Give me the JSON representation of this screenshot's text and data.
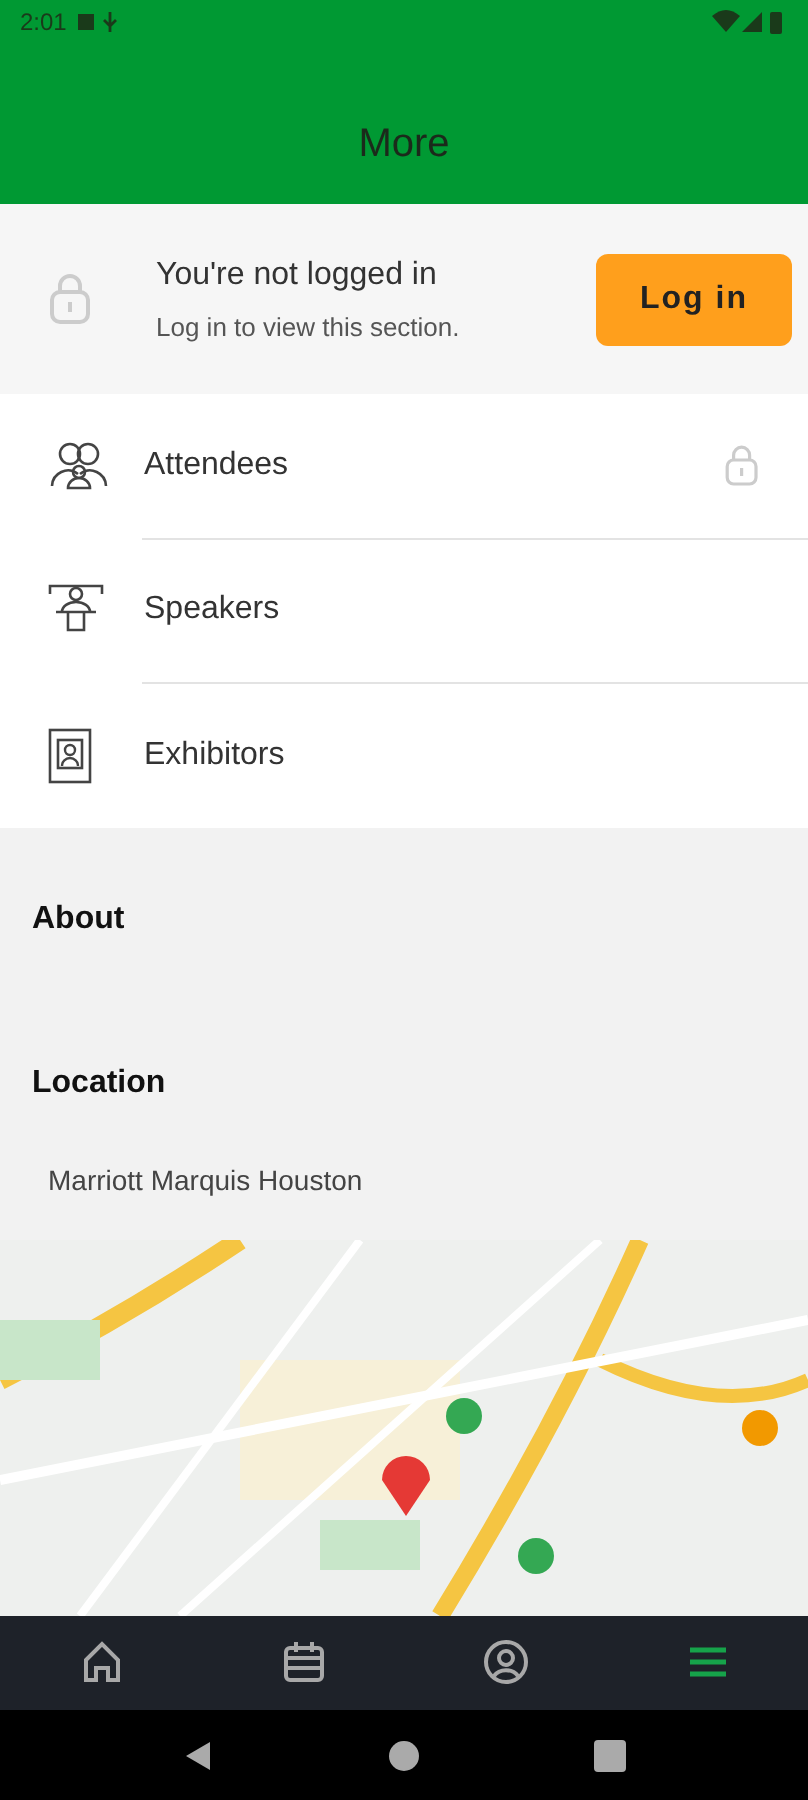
{
  "status_bar": {
    "time": "2:01"
  },
  "app_bar": {
    "title": "More"
  },
  "login_banner": {
    "title": "You're not logged in",
    "subtitle": "Log in to view this section.",
    "button": "Log in"
  },
  "menu_items": [
    {
      "label": "Attendees",
      "kind": "attendees",
      "locked": true
    },
    {
      "label": "Speakers",
      "kind": "speakers",
      "locked": false
    },
    {
      "label": "Exhibitors",
      "kind": "exhibitors",
      "locked": false
    }
  ],
  "about": {
    "heading": "About"
  },
  "location": {
    "heading": "Location",
    "venue": "Marriott Marquis Houston"
  },
  "bottom_nav": [
    {
      "kind": "home",
      "selected": false
    },
    {
      "kind": "calendar",
      "selected": false
    },
    {
      "kind": "profile",
      "selected": false
    },
    {
      "kind": "more",
      "selected": true
    }
  ]
}
